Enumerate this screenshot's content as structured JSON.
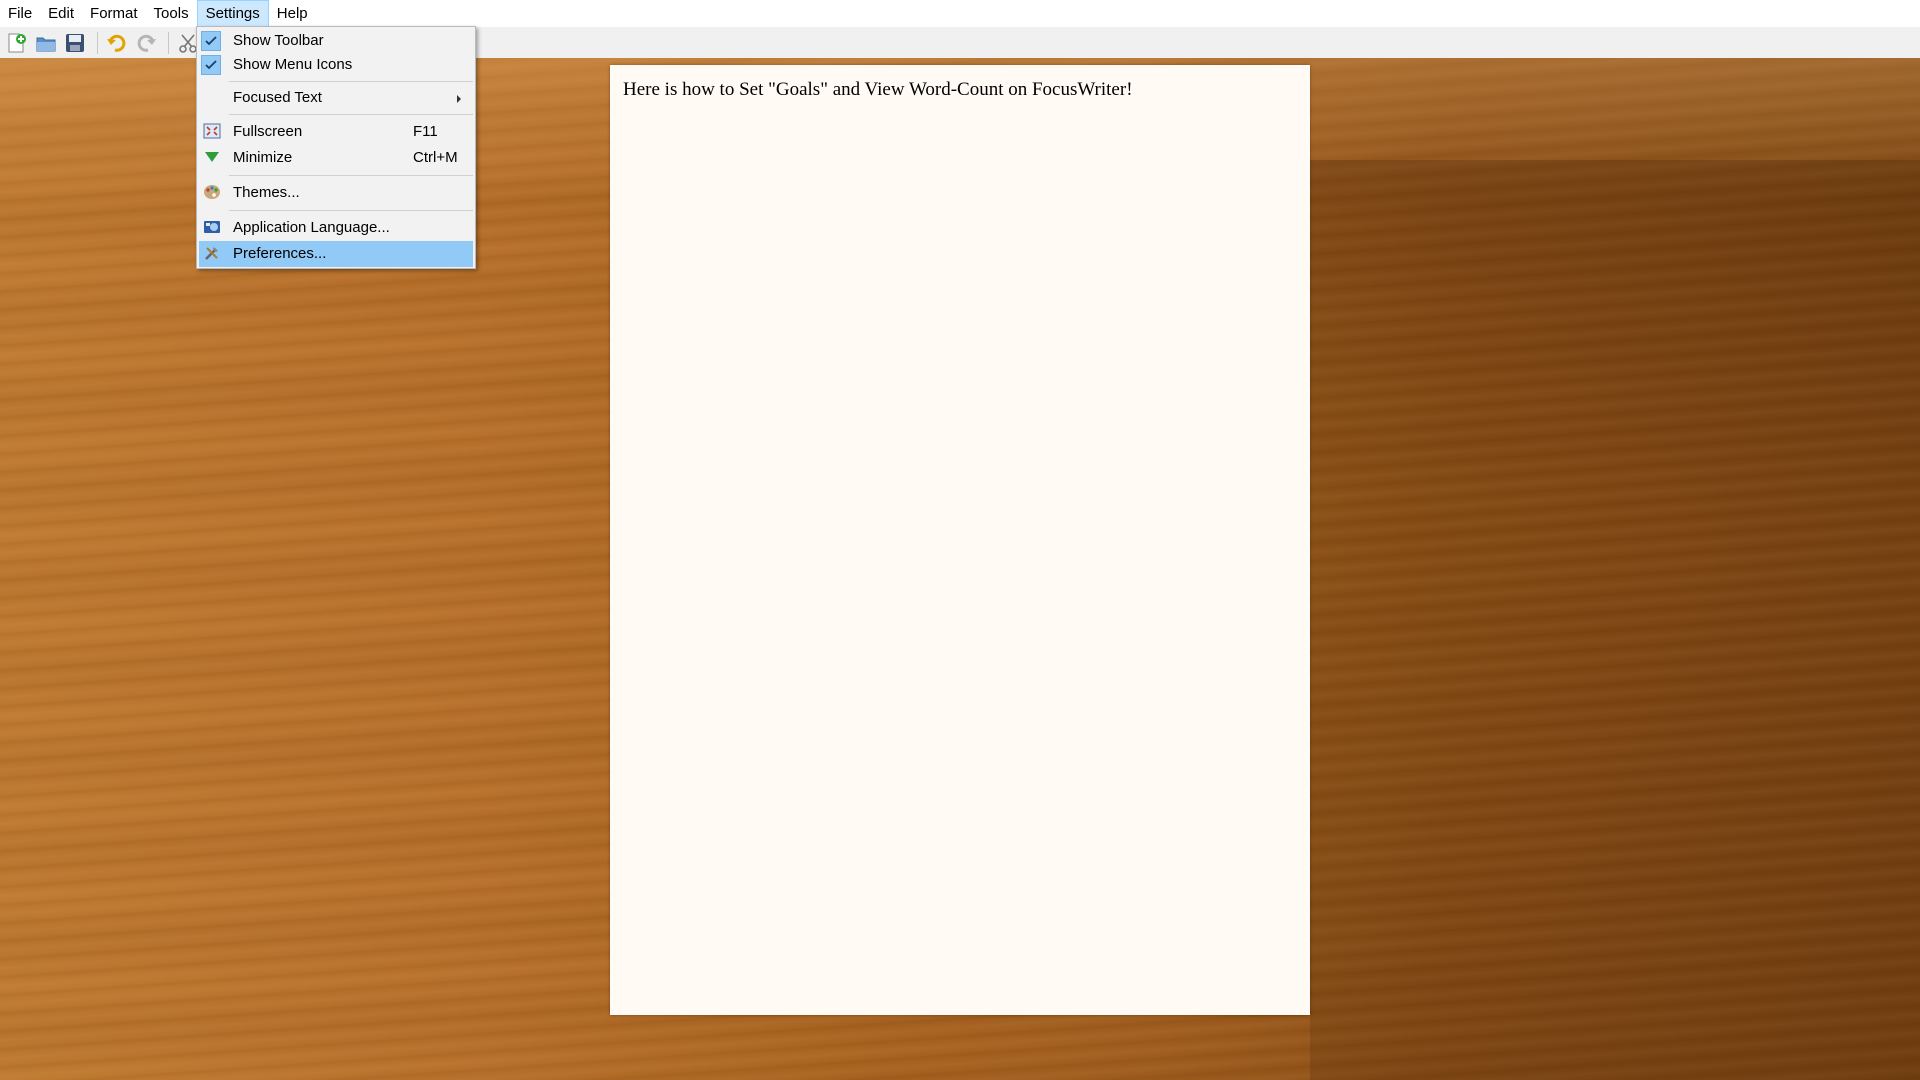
{
  "menubar": {
    "items": [
      "File",
      "Edit",
      "Format",
      "Tools",
      "Settings",
      "Help"
    ],
    "active": "Settings"
  },
  "toolbar": {
    "icons": [
      "new-document-icon",
      "open-folder-icon",
      "save-disk-icon",
      "undo-icon",
      "redo-icon",
      "cut-scissors-icon"
    ]
  },
  "document": {
    "text": "Here is how to Set \"Goals\" and View Word-Count on FocusWriter!"
  },
  "settings_menu": {
    "show_toolbar": {
      "label": "Show Toolbar",
      "checked": true
    },
    "show_menu_icons": {
      "label": "Show Menu Icons",
      "checked": true
    },
    "focused_text": {
      "label": "Focused Text"
    },
    "fullscreen": {
      "label": "Fullscreen",
      "shortcut": "F11",
      "icon": "fullscreen-icon"
    },
    "minimize": {
      "label": "Minimize",
      "shortcut": "Ctrl+M",
      "icon": "minimize-arrow-icon"
    },
    "themes": {
      "label": "Themes...",
      "icon": "palette-icon"
    },
    "app_language": {
      "label": "Application Language...",
      "icon": "language-icon"
    },
    "preferences": {
      "label": "Preferences...",
      "icon": "tools-icon",
      "highlighted": true
    }
  },
  "colors": {
    "menu_highlight": "#91c9f7",
    "active_menu": "#cce8ff",
    "page": "#fffbf4"
  }
}
